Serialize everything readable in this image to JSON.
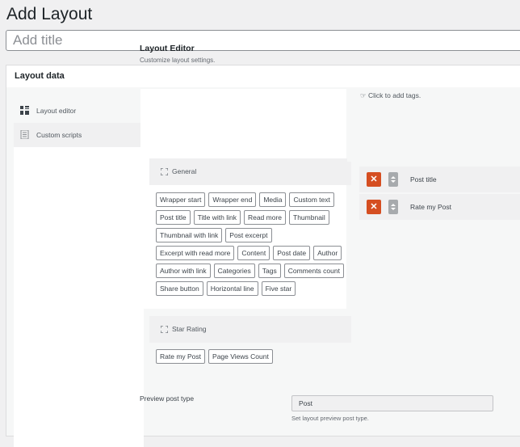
{
  "page": {
    "title": "Add Layout"
  },
  "title_input": {
    "placeholder": "Add title",
    "value": ""
  },
  "metabox": {
    "title": "Layout data"
  },
  "tabs": [
    {
      "label": "Layout editor",
      "icon": "layout-grid-icon"
    },
    {
      "label": "Custom scripts",
      "icon": "document-icon"
    }
  ],
  "panel": {
    "title": "Layout Editor",
    "description": "Customize layout settings."
  },
  "tag_groups": [
    {
      "name": "General",
      "tags": [
        "Wrapper start",
        "Wrapper end",
        "Media",
        "Custom text",
        "Post title",
        "Title with link",
        "Read more",
        "Thumbnail",
        "Thumbnail with link",
        "Post excerpt",
        "Excerpt with read more",
        "Content",
        "Post date",
        "Author",
        "Author with link",
        "Categories",
        "Tags",
        "Comments count",
        "Share button",
        "Horizontal line",
        "Five star"
      ]
    },
    {
      "name": "Star Rating",
      "tags": [
        "Rate my Post",
        "Page Views Count"
      ]
    }
  ],
  "selected": {
    "hint": "Click to add tags.",
    "items": [
      "Post title",
      "Rate my Post"
    ],
    "remove_label": "✕"
  },
  "preview": {
    "label": "Preview post type",
    "value": "Post",
    "help": "Set layout preview post type."
  },
  "colors": {
    "remove": "#d54e21",
    "move": "#a7aaad",
    "accent": "#2271b1"
  }
}
